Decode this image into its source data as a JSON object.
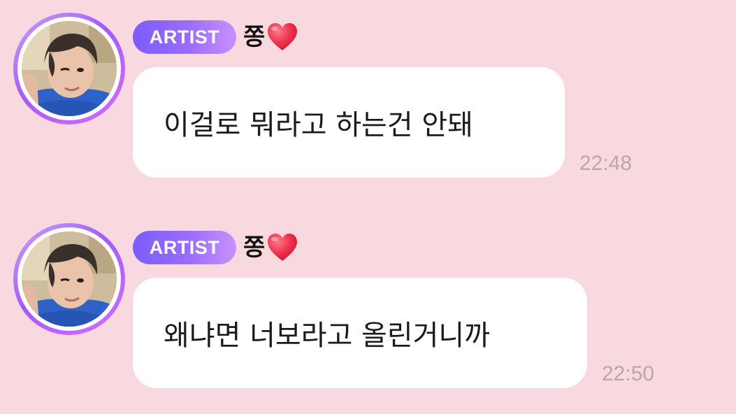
{
  "messages": [
    {
      "badge": "ARTIST",
      "sender": "쫑",
      "sender_emoji": "heart-icon",
      "text": "이걸로 뭐라고 하는건 안돼",
      "time": "22:48"
    },
    {
      "badge": "ARTIST",
      "sender": "쫑",
      "sender_emoji": "heart-icon",
      "text": "왜냐면 너보라고 올린거니까",
      "time": "22:50"
    }
  ],
  "colors": {
    "background": "#f9d9e0",
    "bubble": "#ffffff",
    "badge_gradient_start": "#7b5cff",
    "badge_gradient_end": "#c890ff",
    "heart": "#f0334f",
    "time_text": "#b8a6ab"
  }
}
